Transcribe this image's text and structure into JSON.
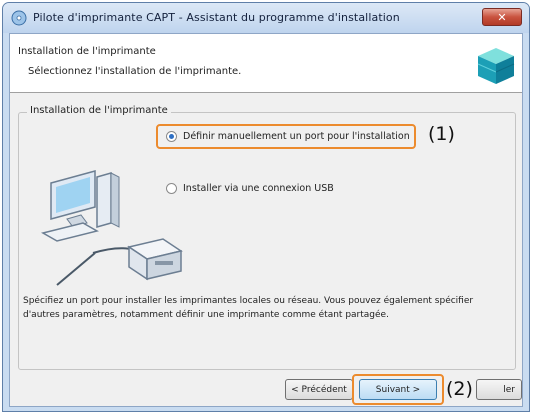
{
  "window": {
    "title": "Pilote d'imprimante CAPT - Assistant du programme d'installation",
    "close_label": "✕"
  },
  "header": {
    "title": "Installation de l'imprimante",
    "subtitle": "Sélectionnez l'installation de l'imprimante."
  },
  "group": {
    "legend": "Installation de l'imprimante",
    "options": [
      {
        "label": "Définir manuellement un port pour l'installation",
        "selected": true
      },
      {
        "label": "Installer via une connexion USB",
        "selected": false
      }
    ],
    "description": "Spécifiez un port pour installer les imprimantes locales ou réseau. Vous pouvez également spécifier d'autres paramètres, notamment définir une imprimante comme étant partagée."
  },
  "buttons": {
    "prev": "< Précédent",
    "next": "Suivant >",
    "cancel": "ler"
  },
  "callouts": {
    "one": "(1)",
    "two": "(2)"
  },
  "colors": {
    "highlight": "#ec8b2e",
    "radio_selected": "#2e6fc4"
  },
  "icons": {
    "title": "installer-disc-icon",
    "header": "printer-box-icon",
    "illustration": "computer-printer-icon"
  }
}
